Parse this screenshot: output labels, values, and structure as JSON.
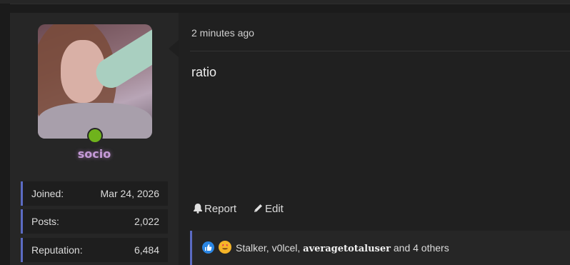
{
  "post": {
    "timestamp": "2 minutes ago",
    "message": "ratio"
  },
  "user": {
    "username": "socio",
    "online": true,
    "colors": {
      "username": "#c59bd8",
      "online_dot": "#6fb31c",
      "accent": "#5b6bc3"
    },
    "stats": [
      {
        "label": "Joined:",
        "value": "Mar 24, 2026"
      },
      {
        "label": "Posts:",
        "value": "2,022"
      },
      {
        "label": "Reputation:",
        "value": "6,484"
      }
    ]
  },
  "actions": {
    "report": {
      "label": "Report",
      "icon": "bell-icon"
    },
    "edit": {
      "label": "Edit",
      "icon": "pencil-icon"
    }
  },
  "reactions": {
    "icons": [
      "like-icon",
      "heart-eyes-icon"
    ],
    "users_plain": "Stalker, v0lcel,",
    "user_bold": "averagetotaluser",
    "others": "and 4 others"
  }
}
